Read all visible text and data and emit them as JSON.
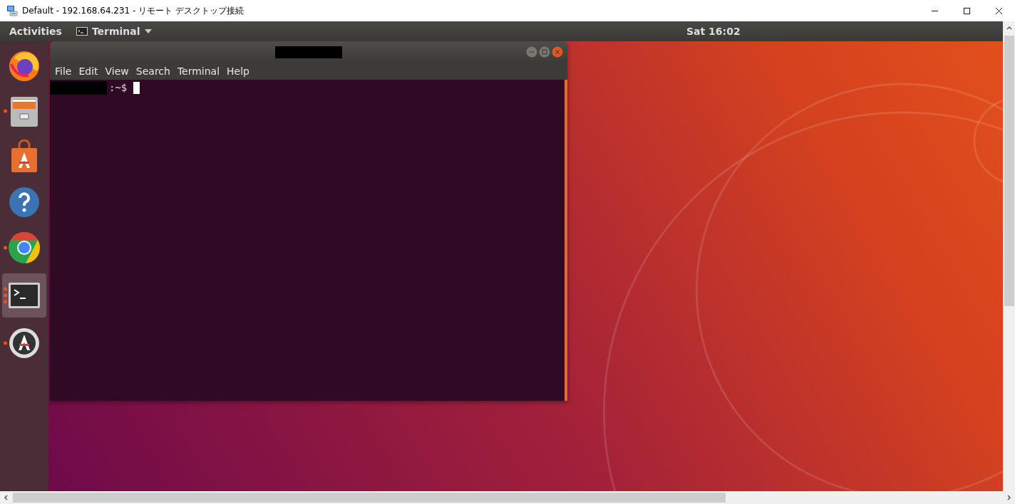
{
  "window": {
    "title": "Default - 192.168.64.231 - リモート デスクトップ接続"
  },
  "top_bar": {
    "activities": "Activities",
    "app_menu": "Terminal",
    "clock": "Sat 16:02"
  },
  "dock": [
    {
      "kind": "firefox",
      "running": false,
      "selected": false
    },
    {
      "kind": "files",
      "running": true,
      "selected": false
    },
    {
      "kind": "software",
      "running": false,
      "selected": false
    },
    {
      "kind": "help",
      "running": false,
      "selected": false
    },
    {
      "kind": "chrome",
      "running": true,
      "selected": false
    },
    {
      "kind": "terminal",
      "running": true,
      "selected": true
    },
    {
      "kind": "updater",
      "running": true,
      "selected": false
    }
  ],
  "terminal": {
    "menu": [
      "File",
      "Edit",
      "View",
      "Search",
      "Terminal",
      "Help"
    ],
    "prompt": ":~$"
  }
}
